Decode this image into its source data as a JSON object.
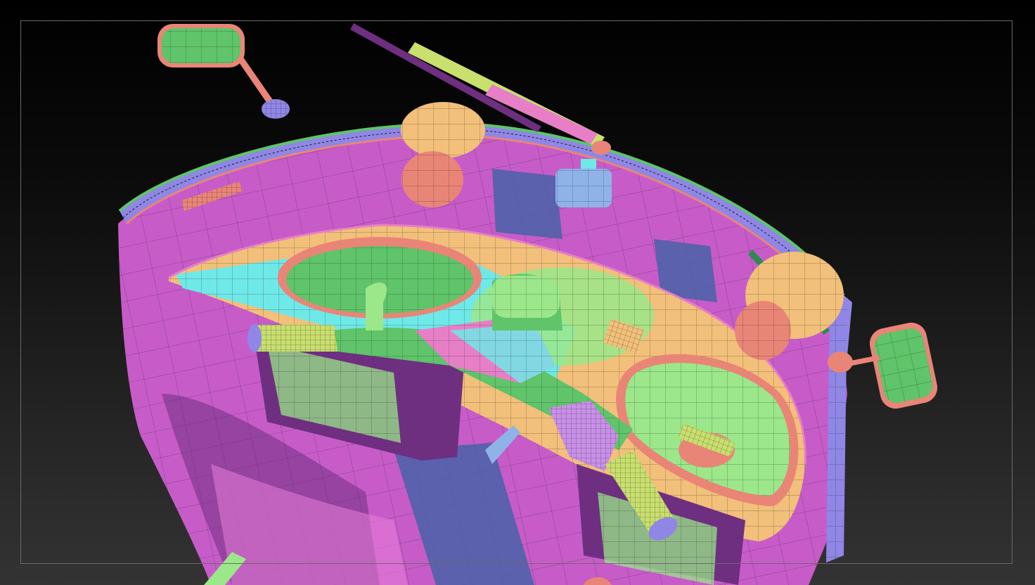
{
  "viewport": {
    "background_top": "#000000",
    "background_bottom": "#333333",
    "frame_color": "#6a6a6a"
  },
  "model": {
    "polygroup_colors": {
      "magenta": "#c75cc9",
      "dark_violet": "#6e2f80",
      "blue_purple": "#8f86e6",
      "cyan": "#6fe8e8",
      "green": "#5fc46a",
      "light_green": "#9be78a",
      "salmon": "#e98577",
      "peach": "#f2c07a",
      "pink": "#e77fc7",
      "yellow_green": "#c9df6e",
      "steel_blue": "#4f62a8",
      "wire": "#1a1a1a"
    }
  }
}
